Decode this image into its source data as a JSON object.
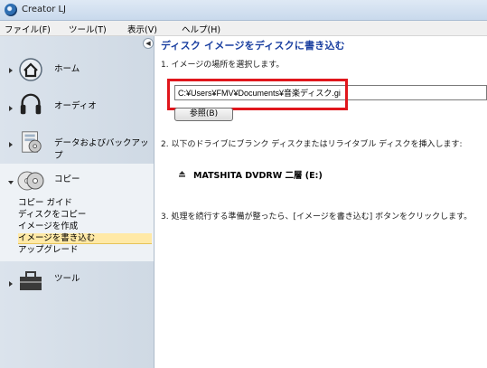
{
  "window": {
    "title": "Creator LJ"
  },
  "menu": [
    "ファイル(F)",
    "ツール(T)",
    "表示(V)",
    "ヘルプ(H)"
  ],
  "sidebar": {
    "collapse_glyph": "◀",
    "items": [
      {
        "label": "ホーム",
        "icon": "home-icon"
      },
      {
        "label": "オーディオ",
        "icon": "headphones-icon"
      },
      {
        "label": "データおよびバックアップ",
        "icon": "data-backup-icon"
      },
      {
        "label": "コピー",
        "icon": "disc-copy-icon"
      },
      {
        "label": "ツール",
        "icon": "toolbox-icon"
      }
    ],
    "copy_subitems": [
      "コピー ガイド",
      "ディスクをコピー",
      "イメージを作成",
      "イメージを書き込む",
      "アップグレード"
    ],
    "selected_subitem": "イメージを書き込む"
  },
  "main": {
    "title": "ディスク イメージをディスクに書き込む",
    "step1": "1. イメージの場所を選択します。",
    "path_value": "C:¥Users¥FMV¥Documents¥音楽ディスク.gi",
    "browse_label": "参照(B)",
    "step2": "2. 以下のドライブにブランク ディスクまたはリライタブル ディスクを挿入します:",
    "drive_label": "MATSHITA DVDRW 二層 (E:)",
    "step3": "3. 処理を続行する準備が整ったら、[イメージを書き込む] ボタンをクリックします。",
    "highlight_color": "#e0161c"
  }
}
